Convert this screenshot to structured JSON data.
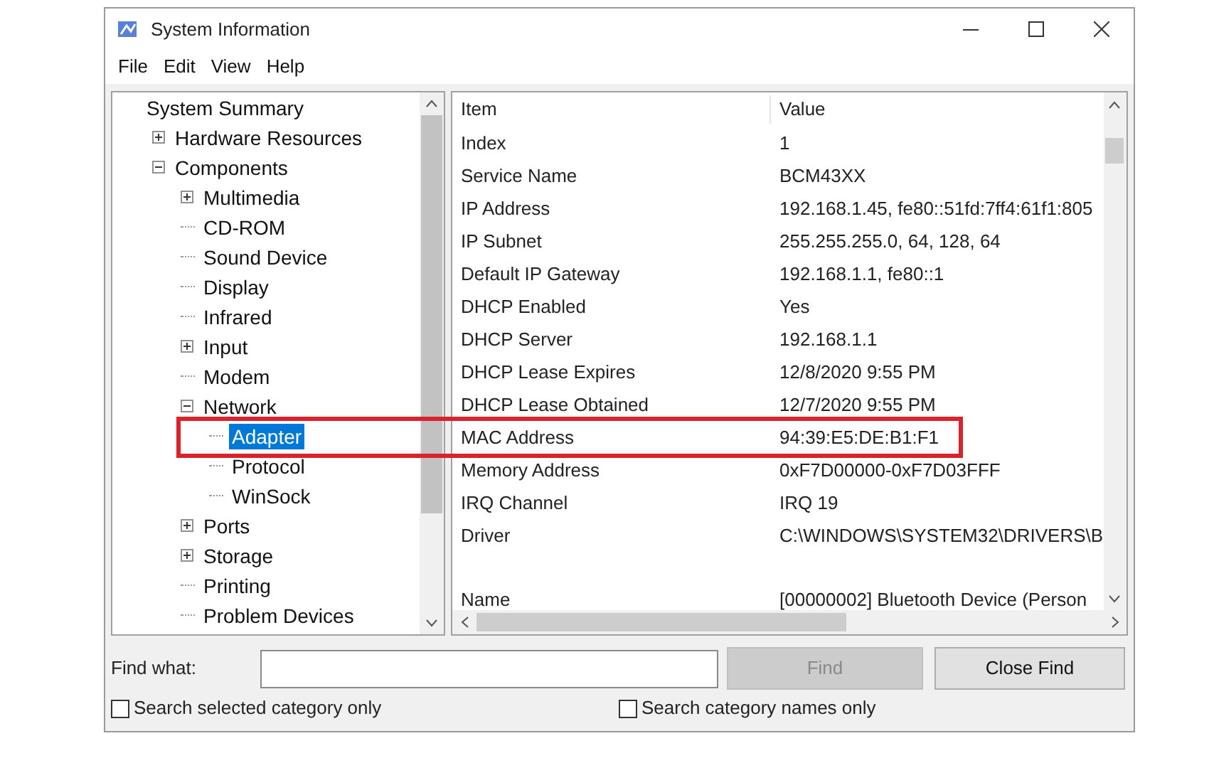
{
  "window": {
    "title": "System Information"
  },
  "menu": [
    "File",
    "Edit",
    "View",
    "Help"
  ],
  "tree": [
    {
      "label": "System Summary",
      "selected": false,
      "children": [
        {
          "label": "Hardware Resources",
          "selected": false,
          "expanded": false
        },
        {
          "label": "Components",
          "selected": false,
          "expanded": true,
          "children": [
            {
              "label": "Multimedia",
              "selected": false,
              "expanded": false
            },
            {
              "label": "CD-ROM",
              "selected": false
            },
            {
              "label": "Sound Device",
              "selected": false
            },
            {
              "label": "Display",
              "selected": false
            },
            {
              "label": "Infrared",
              "selected": false
            },
            {
              "label": "Input",
              "selected": false,
              "expanded": false
            },
            {
              "label": "Modem",
              "selected": false
            },
            {
              "label": "Network",
              "selected": false,
              "expanded": true,
              "children": [
                {
                  "label": "Adapter",
                  "selected": true
                },
                {
                  "label": "Protocol",
                  "selected": false
                },
                {
                  "label": "WinSock",
                  "selected": false
                }
              ]
            },
            {
              "label": "Ports",
              "selected": false,
              "expanded": false
            },
            {
              "label": "Storage",
              "selected": false,
              "expanded": false
            },
            {
              "label": "Printing",
              "selected": false
            },
            {
              "label": "Problem Devices",
              "selected": false
            }
          ]
        }
      ]
    }
  ],
  "table": {
    "columns": [
      "Item",
      "Value"
    ],
    "rows": [
      {
        "kind": "entry",
        "item": "Index",
        "value": "1"
      },
      {
        "kind": "entry",
        "item": "Service Name",
        "value": "BCM43XX"
      },
      {
        "kind": "entry",
        "item": "IP Address",
        "value": "192.168.1.45, fe80::51fd:7ff4:61f1:805"
      },
      {
        "kind": "entry",
        "item": "IP Subnet",
        "value": "255.255.255.0, 64, 128, 64"
      },
      {
        "kind": "entry",
        "item": "Default IP Gateway",
        "value": "192.168.1.1, fe80::1"
      },
      {
        "kind": "entry",
        "item": "DHCP Enabled",
        "value": "Yes"
      },
      {
        "kind": "entry",
        "item": "DHCP Server",
        "value": "192.168.1.1"
      },
      {
        "kind": "entry",
        "item": "DHCP Lease Expires",
        "value": "12/8/2020 9:55 PM"
      },
      {
        "kind": "entry",
        "item": "DHCP Lease Obtained",
        "value": "12/7/2020 9:55 PM"
      },
      {
        "kind": "entry",
        "item": "MAC Address",
        "value": "94:39:E5:DE:B1:F1"
      },
      {
        "kind": "entry",
        "item": "Memory Address",
        "value": "0xF7D00000-0xF7D03FFF"
      },
      {
        "kind": "entry",
        "item": "IRQ Channel",
        "value": "IRQ 19"
      },
      {
        "kind": "entry",
        "item": "Driver",
        "value": "C:\\WINDOWS\\SYSTEM32\\DRIVERS\\B"
      },
      {
        "kind": "gap"
      },
      {
        "kind": "entry",
        "item": "Name",
        "value": "[00000002] Bluetooth Device (Person"
      }
    ]
  },
  "find": {
    "label": "Find what:",
    "find_button": {
      "label": "Find",
      "disabled": true
    },
    "close_button": "Close Find",
    "options": [
      {
        "label": "Search selected category only",
        "checked": false
      },
      {
        "label": "Search category names only",
        "checked": false
      }
    ]
  }
}
